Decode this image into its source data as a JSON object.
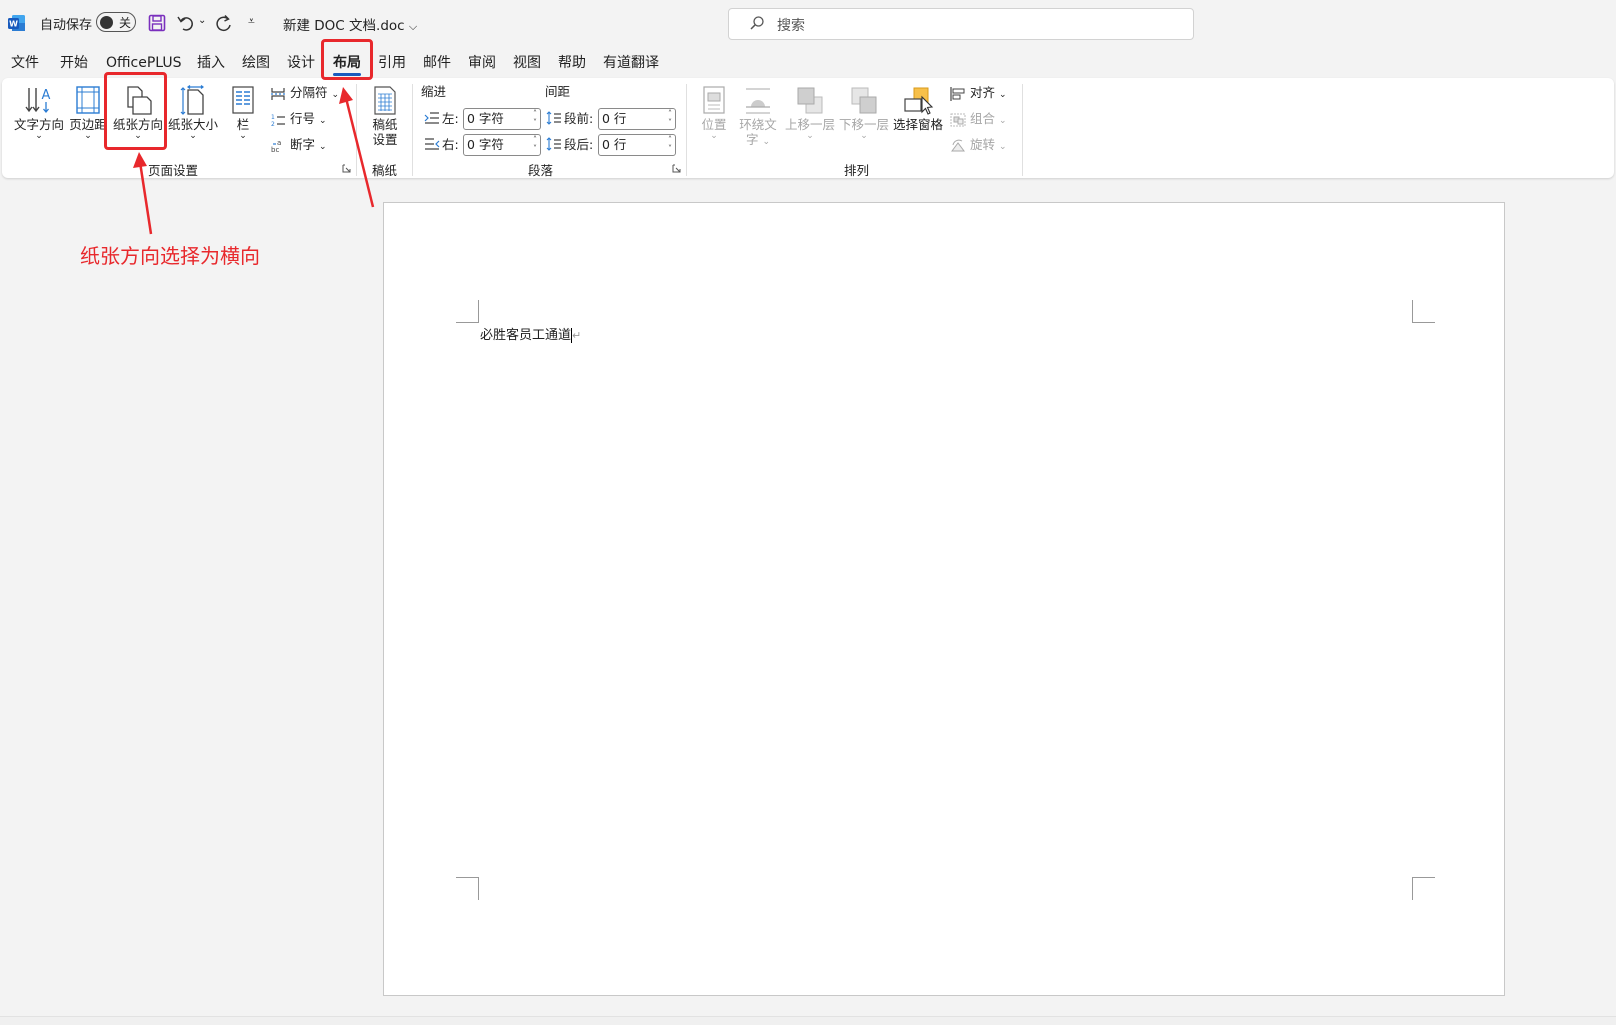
{
  "titlebar": {
    "autosave_label": "自动保存",
    "autosave_state": "关",
    "doc_title": "新建 DOC 文档.doc",
    "search_placeholder": "搜索"
  },
  "menu": {
    "tabs": [
      "文件",
      "开始",
      "OfficePLUS",
      "插入",
      "绘图",
      "设计",
      "布局",
      "引用",
      "邮件",
      "审阅",
      "视图",
      "帮助",
      "有道翻译"
    ],
    "active_tab": "布局"
  },
  "ribbon": {
    "page_setup": {
      "group_label": "页面设置",
      "text_direction": "文字方向",
      "margins": "页边距",
      "orientation": "纸张方向",
      "size": "纸张大小",
      "columns": "栏",
      "breaks": "分隔符",
      "line_numbers": "行号",
      "hyphenation": "断字"
    },
    "manuscript": {
      "group_label": "稿纸",
      "button_line1": "稿纸",
      "button_line2": "设置"
    },
    "paragraph": {
      "group_label": "段落",
      "indent_label": "缩进",
      "spacing_label": "间距",
      "left_label": "左:",
      "right_label": "右:",
      "before_label": "段前:",
      "after_label": "段后:",
      "left_value": "0 字符",
      "right_value": "0 字符",
      "before_value": "0 行",
      "after_value": "0 行"
    },
    "arrange": {
      "group_label": "排列",
      "position": "位置",
      "wrap_text_line1": "环绕文",
      "wrap_text_line2": "字",
      "bring_forward": "上移一层",
      "send_backward": "下移一层",
      "selection_pane": "选择窗格",
      "align": "对齐",
      "group": "组合",
      "rotate": "旋转"
    }
  },
  "document": {
    "text": "必胜客员工通道"
  },
  "annotation": {
    "text": "纸张方向选择为横向",
    "color": "#e8282c"
  },
  "colors": {
    "word_blue": "#185abd",
    "save_purple": "#7a2fbd",
    "accent": "#e8282c"
  }
}
